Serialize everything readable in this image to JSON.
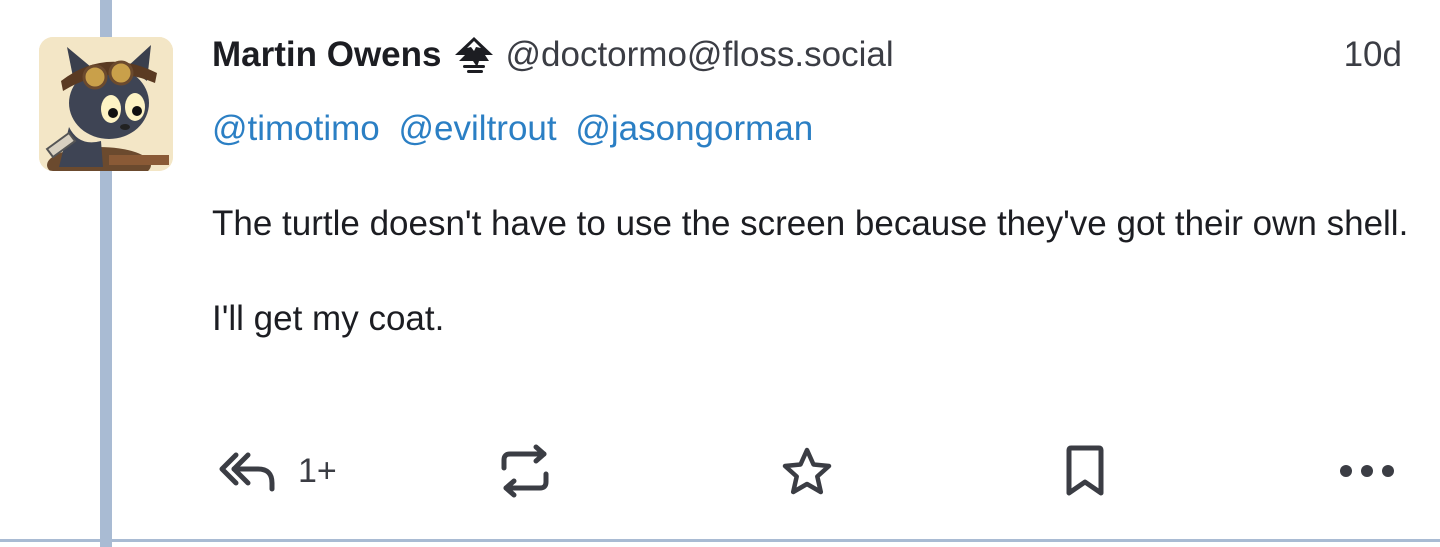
{
  "post": {
    "author": {
      "display_name": "Martin Owens",
      "name_emoji": "inkscape-logo-icon",
      "handle": "@doctormo@floss.social",
      "avatar": "steampunk-cat-avatar"
    },
    "timestamp": "10d",
    "mentions": [
      "@timotimo",
      "@eviltrout",
      "@jasongorman"
    ],
    "paragraphs": [
      "The turtle doesn't have to use the screen because they've got their own shell.",
      "I'll get my coat."
    ],
    "actions": {
      "reply": {
        "icon": "reply-all-icon",
        "count": "1+"
      },
      "boost": {
        "icon": "repeat-icon"
      },
      "favourite": {
        "icon": "star-icon"
      },
      "bookmark": {
        "icon": "bookmark-icon"
      },
      "more": {
        "icon": "more-horizontal-icon"
      }
    }
  },
  "colors": {
    "link": "#2b7fc4",
    "thread_line": "#a9bbd3",
    "text": "#1c1d22",
    "secondary_text": "#3b3d44",
    "icon": "#3b3d44"
  }
}
